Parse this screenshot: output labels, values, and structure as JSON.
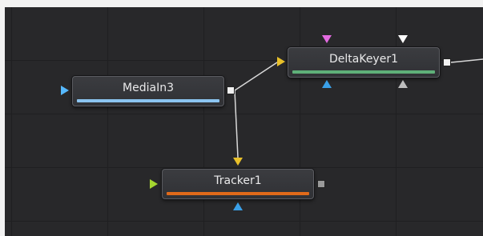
{
  "canvas": {
    "background": "#28282a",
    "grid_color": "#1f1f21"
  },
  "nodes": {
    "media_in": {
      "title": "MediaIn3",
      "accent": "#8cc4f0"
    },
    "delta_keyer": {
      "title": "DeltaKeyer1",
      "accent": "#5fb079"
    },
    "tracker": {
      "title": "Tracker1",
      "accent": "#e06a1a"
    }
  },
  "port_colors": {
    "background_input": "#e8c02a",
    "foreground_input": "#56b9ff",
    "effect_mask": "#3aa0e8",
    "garbage_matte": "#ffffff",
    "solid_matte": "#e36be0",
    "tracker_input": "#a5d630",
    "clean_plate": "#bdbdbd",
    "output": "#f5f5f5",
    "output_disabled": "#9a9a9a"
  },
  "wire_color": "#d8d8d8"
}
